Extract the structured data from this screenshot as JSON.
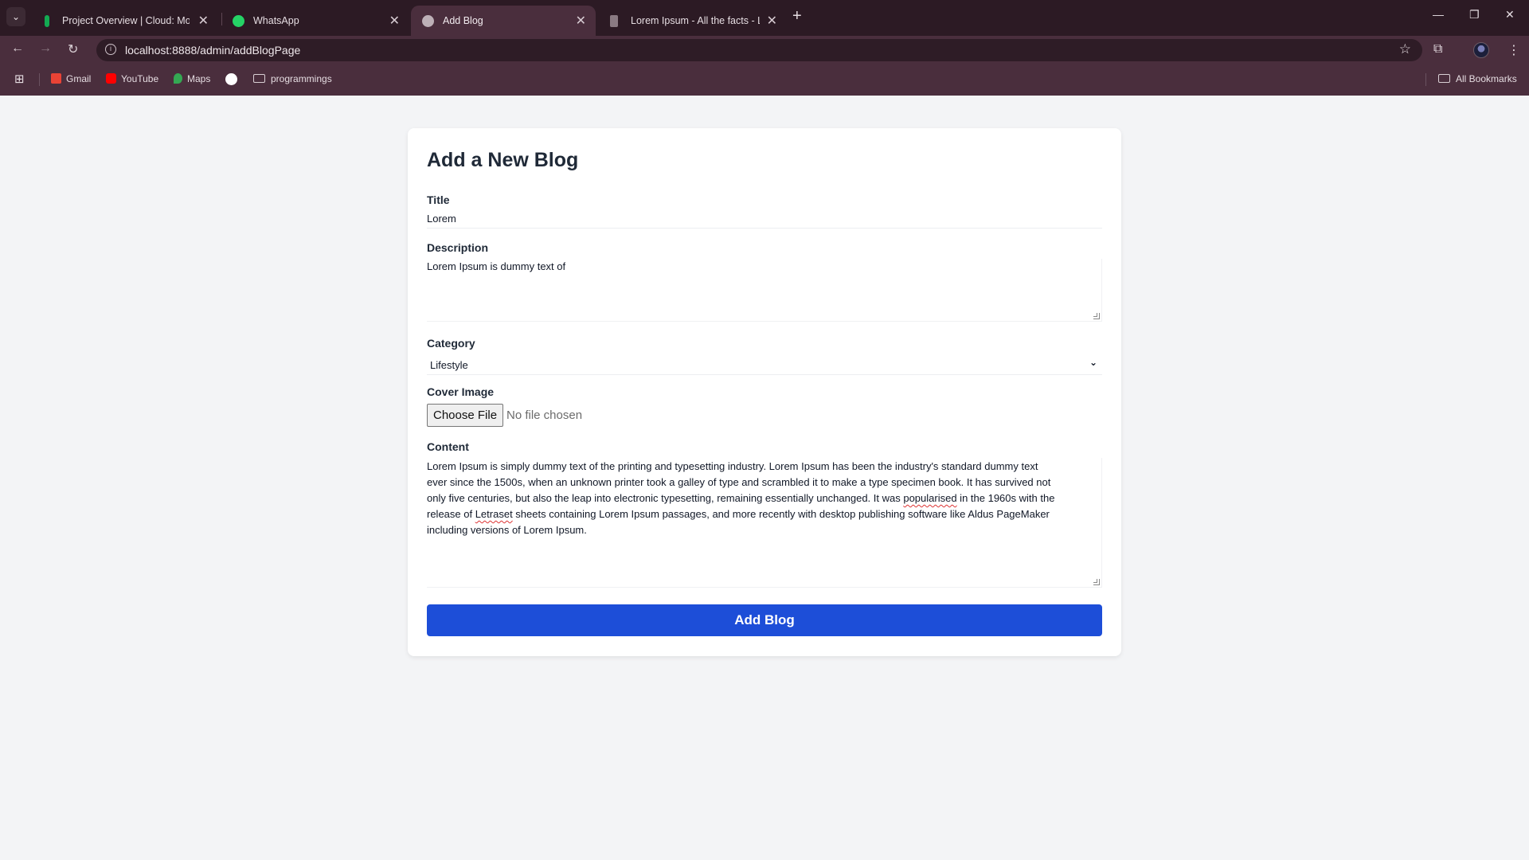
{
  "browser": {
    "tabs": [
      {
        "title": "Project Overview | Cloud: Mongo",
        "favicon_color": "#13aa52"
      },
      {
        "title": "WhatsApp",
        "favicon_color": "#25d366"
      },
      {
        "title": "Add Blog",
        "favicon_color": "#bdb0b7"
      },
      {
        "title": "Lorem Ipsum - All the facts - Li",
        "favicon_color": "#8a7a82"
      }
    ],
    "active_tab": 2,
    "new_tab_label": "+",
    "url": "localhost:8888/admin/addBlogPage",
    "bookmarks": [
      {
        "label": "Gmail",
        "icon": "gmail-icon",
        "color": "#ea4335"
      },
      {
        "label": "YouTube",
        "icon": "youtube-icon",
        "color": "#ff0000"
      },
      {
        "label": "Maps",
        "icon": "maps-icon",
        "color": "#34a853"
      },
      {
        "label": "",
        "icon": "github-icon",
        "color": "#ffffff"
      },
      {
        "label": "programmings",
        "icon": "folder-icon",
        "color": "#d9cfd4"
      }
    ],
    "all_bookmarks_label": "All Bookmarks"
  },
  "form": {
    "heading": "Add a New Blog",
    "title_label": "Title",
    "title_value": "Lorem",
    "description_label": "Description",
    "description_value": "Lorem Ipsum is  dummy text of",
    "category_label": "Category",
    "category_value": "Lifestyle",
    "cover_label": "Cover Image",
    "file_button": "Choose File",
    "file_status": "No file chosen",
    "content_label": "Content",
    "content_lines": [
      "Lorem Ipsum is simply dummy text of the printing and typesetting industry. Lorem Ipsum has been the industry's standard dummy text",
      "ever since the 1500s, when an unknown printer took a galley of type and scrambled it to make a type specimen book. It has survived not",
      "only five centuries, but also the leap into electronic typesetting, remaining essentially unchanged. It was ",
      "popularised",
      " in the 1960s with the",
      "release of ",
      "Letraset",
      " sheets containing Lorem Ipsum passages, and more recently with desktop publishing software like Aldus PageMaker",
      "including versions of Lorem Ipsum."
    ],
    "submit_label": "Add Blog",
    "accent_color": "#1d4ed8"
  }
}
